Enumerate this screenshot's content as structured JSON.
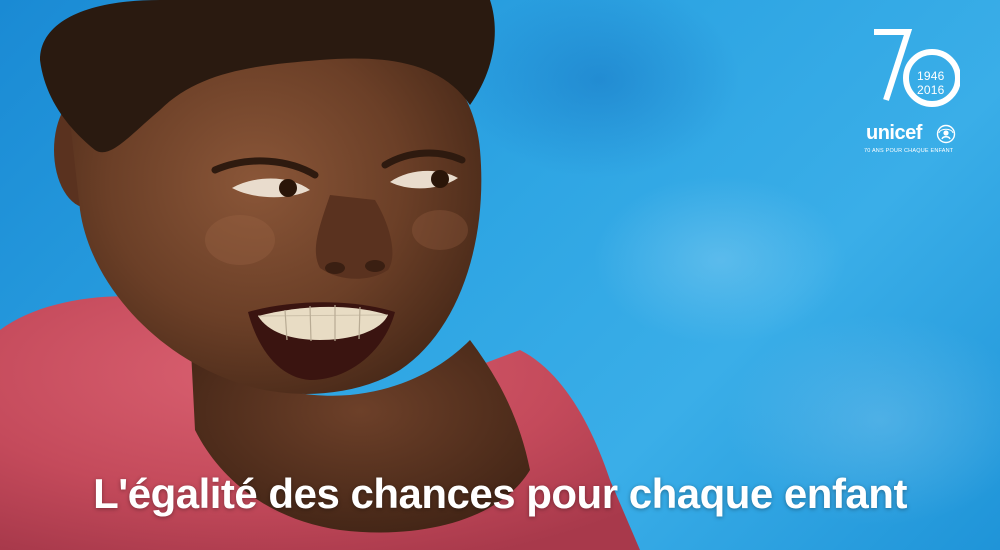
{
  "headline": "L'égalité des chances pour chaque enfant",
  "logo": {
    "anniversary_number": "70",
    "year_start": "1946",
    "year_end": "2016",
    "brand": "unicef",
    "tagline": "70 ANS POUR CHAQUE ENFANT"
  },
  "colors": {
    "background": "#2ea5e3",
    "text": "#ffffff",
    "shirt": "#c94a5a"
  },
  "icons": [
    "unicef-emblem-icon"
  ]
}
